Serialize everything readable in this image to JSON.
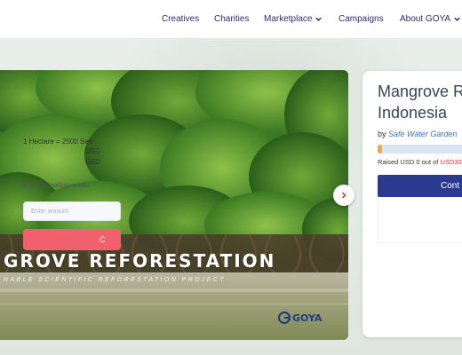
{
  "nav": {
    "items": [
      {
        "label": "Creatives",
        "has_dropdown": false
      },
      {
        "label": "Charities",
        "has_dropdown": false
      },
      {
        "label": "Marketplace",
        "has_dropdown": true
      },
      {
        "label": "Campaigns",
        "has_dropdown": false
      },
      {
        "label": "About GOYA",
        "has_dropdown": true
      }
    ]
  },
  "hero": {
    "title": "GROVE REFORESTATION",
    "subtitle": "NABLE SCIENTIFIC REFORESTATION PROJECT",
    "logo_text": "GOYA",
    "next_icon": "chevron-right-icon"
  },
  "campaign": {
    "title_line1": "Mangrove R",
    "title_line2": "Indonesia",
    "by_prefix": "by",
    "by_link": "Safe Water Garden",
    "progress_fraction": 0.02,
    "raised_text": "Raised USD 0 out of",
    "raised_target": "USD30",
    "contribute_label": "Cont",
    "unit_text": "1 Hectare = 2500 See",
    "price_line1": "USD",
    "price_line2": "USD",
    "enter_label": "Enter donation amou",
    "amount_placeholder": "Enter amount",
    "donate_label": "C"
  },
  "colors": {
    "nav_text": "#2b2f6b",
    "accent_navy": "#2b3a8f",
    "donate_red": "#f0616d",
    "progress_orange": "#f0a93b",
    "link_blue": "#3b73c9",
    "target_red": "#d63b3b"
  }
}
